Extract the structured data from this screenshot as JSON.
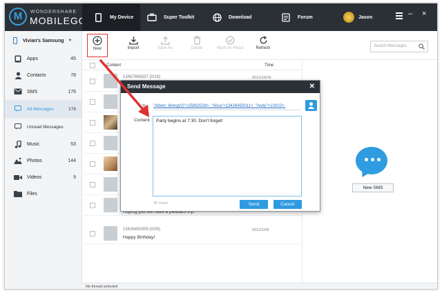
{
  "app": {
    "brand_top": "WONDERSHARE",
    "brand_bottom": "MOBILEGO",
    "logo_letter": "M"
  },
  "nav": {
    "tabs": [
      {
        "label": "My Device",
        "icon": "phone-icon"
      },
      {
        "label": "Super Toolkit",
        "icon": "toolbox-icon"
      },
      {
        "label": "Download",
        "icon": "globe-icon"
      },
      {
        "label": "Forum",
        "icon": "forum-icon"
      }
    ],
    "user": "Jason"
  },
  "sidebar": {
    "device": "Vivian's Samsung",
    "items": [
      {
        "label": "Apps",
        "count": "45",
        "icon": "apps-icon"
      },
      {
        "label": "Contacts",
        "count": "78",
        "icon": "contacts-icon"
      },
      {
        "label": "SMS",
        "count": "176",
        "icon": "sms-icon"
      },
      {
        "label": "All Messages",
        "count": "176",
        "icon": "message-icon"
      },
      {
        "label": "Unread Messages",
        "count": "",
        "icon": "unread-icon"
      },
      {
        "label": "Music",
        "count": "53",
        "icon": "music-icon"
      },
      {
        "label": "Photos",
        "count": "144",
        "icon": "photos-icon"
      },
      {
        "label": "Videos",
        "count": "9",
        "icon": "videos-icon"
      },
      {
        "label": "Files",
        "count": "",
        "icon": "files-icon"
      }
    ]
  },
  "toolbar": {
    "new": "New",
    "import": "Import",
    "save_as": "Save As",
    "delete": "Delete",
    "mark_as_read": "Mark As Read",
    "refresh": "Refresh",
    "search_placeholder": "Search Messages"
  },
  "list": {
    "col_content": "Content",
    "col_time": "Time",
    "rows": [
      {
        "name": "13467889537  (0/19)",
        "text": "",
        "time": "2012/10/16"
      },
      {
        "name": "",
        "text": "",
        "time": ""
      },
      {
        "name": "",
        "text": "",
        "time": ""
      },
      {
        "name": "",
        "text": "",
        "time": ""
      },
      {
        "name": "",
        "text": "",
        "time": ""
      },
      {
        "name": "",
        "text": "",
        "time": ""
      },
      {
        "name": "",
        "text": "",
        "time": ""
      },
      {
        "name": "",
        "text": "Hoping you will have a pleasant trip.",
        "time": ""
      },
      {
        "name": "13426450009  (0/30)",
        "text": "Happy Birthday!",
        "time": "2012/1/29"
      }
    ]
  },
  "right_pane": {
    "new_sms": "New SMS"
  },
  "status": "No thread selected",
  "dialog": {
    "title": "Send Message",
    "to_label": "To :",
    "recipients": "\"Albert, Wong(V)\"<25892028>;  \"Alisa\"<13426450011>;  \"Andy\"<10010>;",
    "content_label": "Content :",
    "content": "Party begins at 7:30. Don't forget!",
    "char_count": "35 chars",
    "send": "Send",
    "cancel": "Cancel"
  },
  "colors": {
    "accent": "#2f9be0",
    "topbar": "#2b2f36",
    "annotation": "#e03030"
  }
}
